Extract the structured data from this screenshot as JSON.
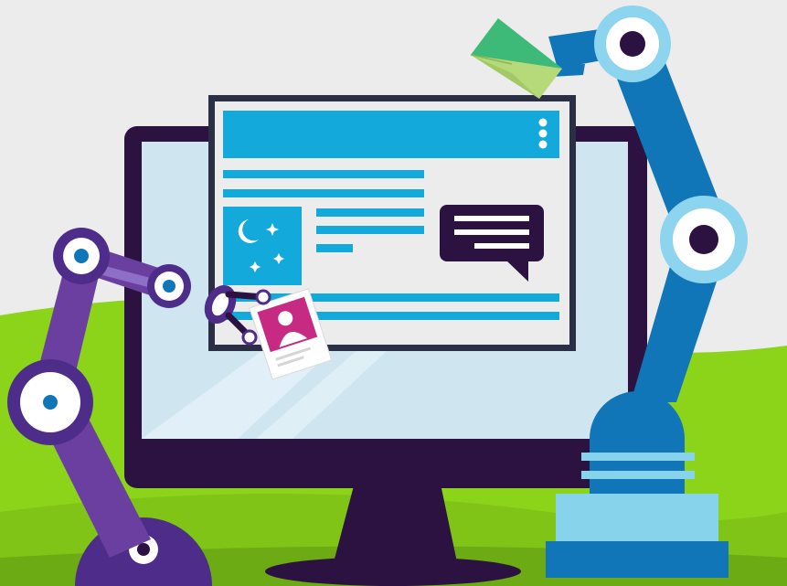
{
  "colors": {
    "background": "#ececec",
    "grass": "#8bd41a",
    "grass_dark": "#6cab14",
    "monitor_frame": "#2c1240",
    "screen": "#cfe6f1",
    "window_bg": "#ececec",
    "window_border": "#2a2f45",
    "accent_blue": "#13a9db",
    "chat_bubble": "#2c1240",
    "photo_card": "#c62a83",
    "envelope": "#b6d97a",
    "envelope_flap": "#3dba78",
    "purple_arm": "#6b3fa0",
    "purple_joint": "#4e2c8a",
    "blue_arm": "#1176b8",
    "blue_joint_ring": "#8dd4ef",
    "blue_base_top": "#87d3ec",
    "blue_base_bottom": "#1176b8"
  },
  "icons": {
    "menu": "kebab-menu-icon",
    "night": "moon-and-stars-icon",
    "chat": "chat-bubble-icon",
    "profile": "user-profile-card-icon",
    "mail": "envelope-icon"
  },
  "robots": {
    "left": "purple-robot-arm",
    "right": "blue-robot-arm"
  }
}
